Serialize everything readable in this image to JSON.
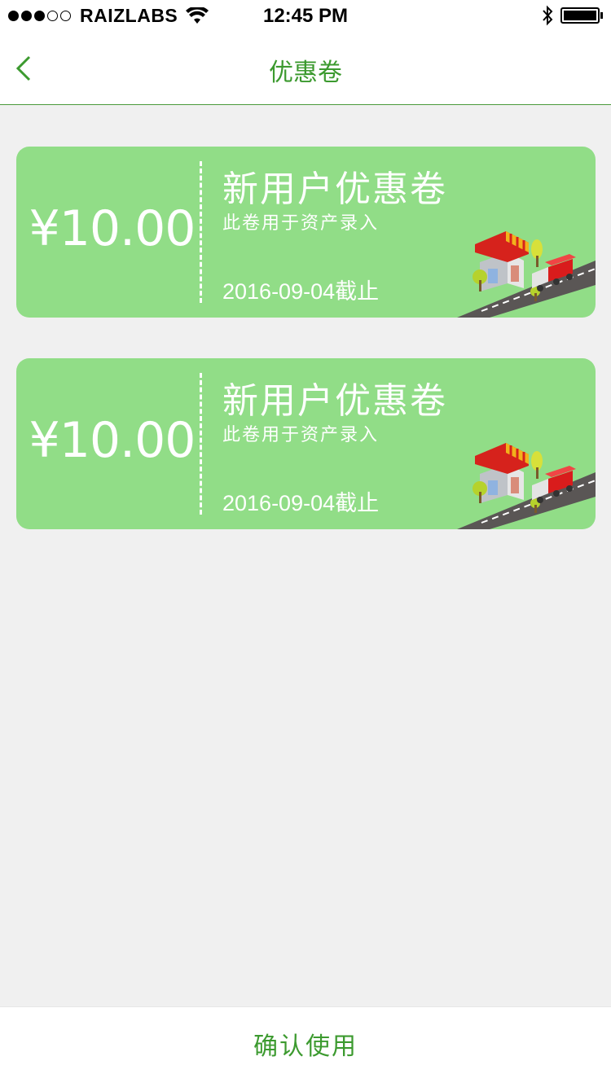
{
  "status_bar": {
    "carrier": "RAIZLABS",
    "time": "12:45 PM",
    "signal_icon": "signal-dots-icon",
    "wifi_icon": "wifi-icon",
    "bluetooth_icon": "bluetooth-icon",
    "battery_icon": "battery-icon"
  },
  "nav": {
    "title": "优惠卷",
    "back_icon": "chevron-left-icon"
  },
  "coupons": [
    {
      "price": "¥10.00",
      "title": "新用户优惠卷",
      "description": "此卷用于资产录入",
      "expiry": "2016-09-04截止",
      "illustration": "shop-and-truck-icon"
    },
    {
      "price": "¥10.00",
      "title": "新用户优惠卷",
      "description": "此卷用于资产录入",
      "expiry": "2016-09-04截止",
      "illustration": "shop-and-truck-icon"
    }
  ],
  "footer": {
    "confirm_label": "确认使用"
  },
  "colors": {
    "accent": "#3c9a2f",
    "coupon_bg": "#91dd87",
    "page_bg": "#f0f0f0"
  }
}
